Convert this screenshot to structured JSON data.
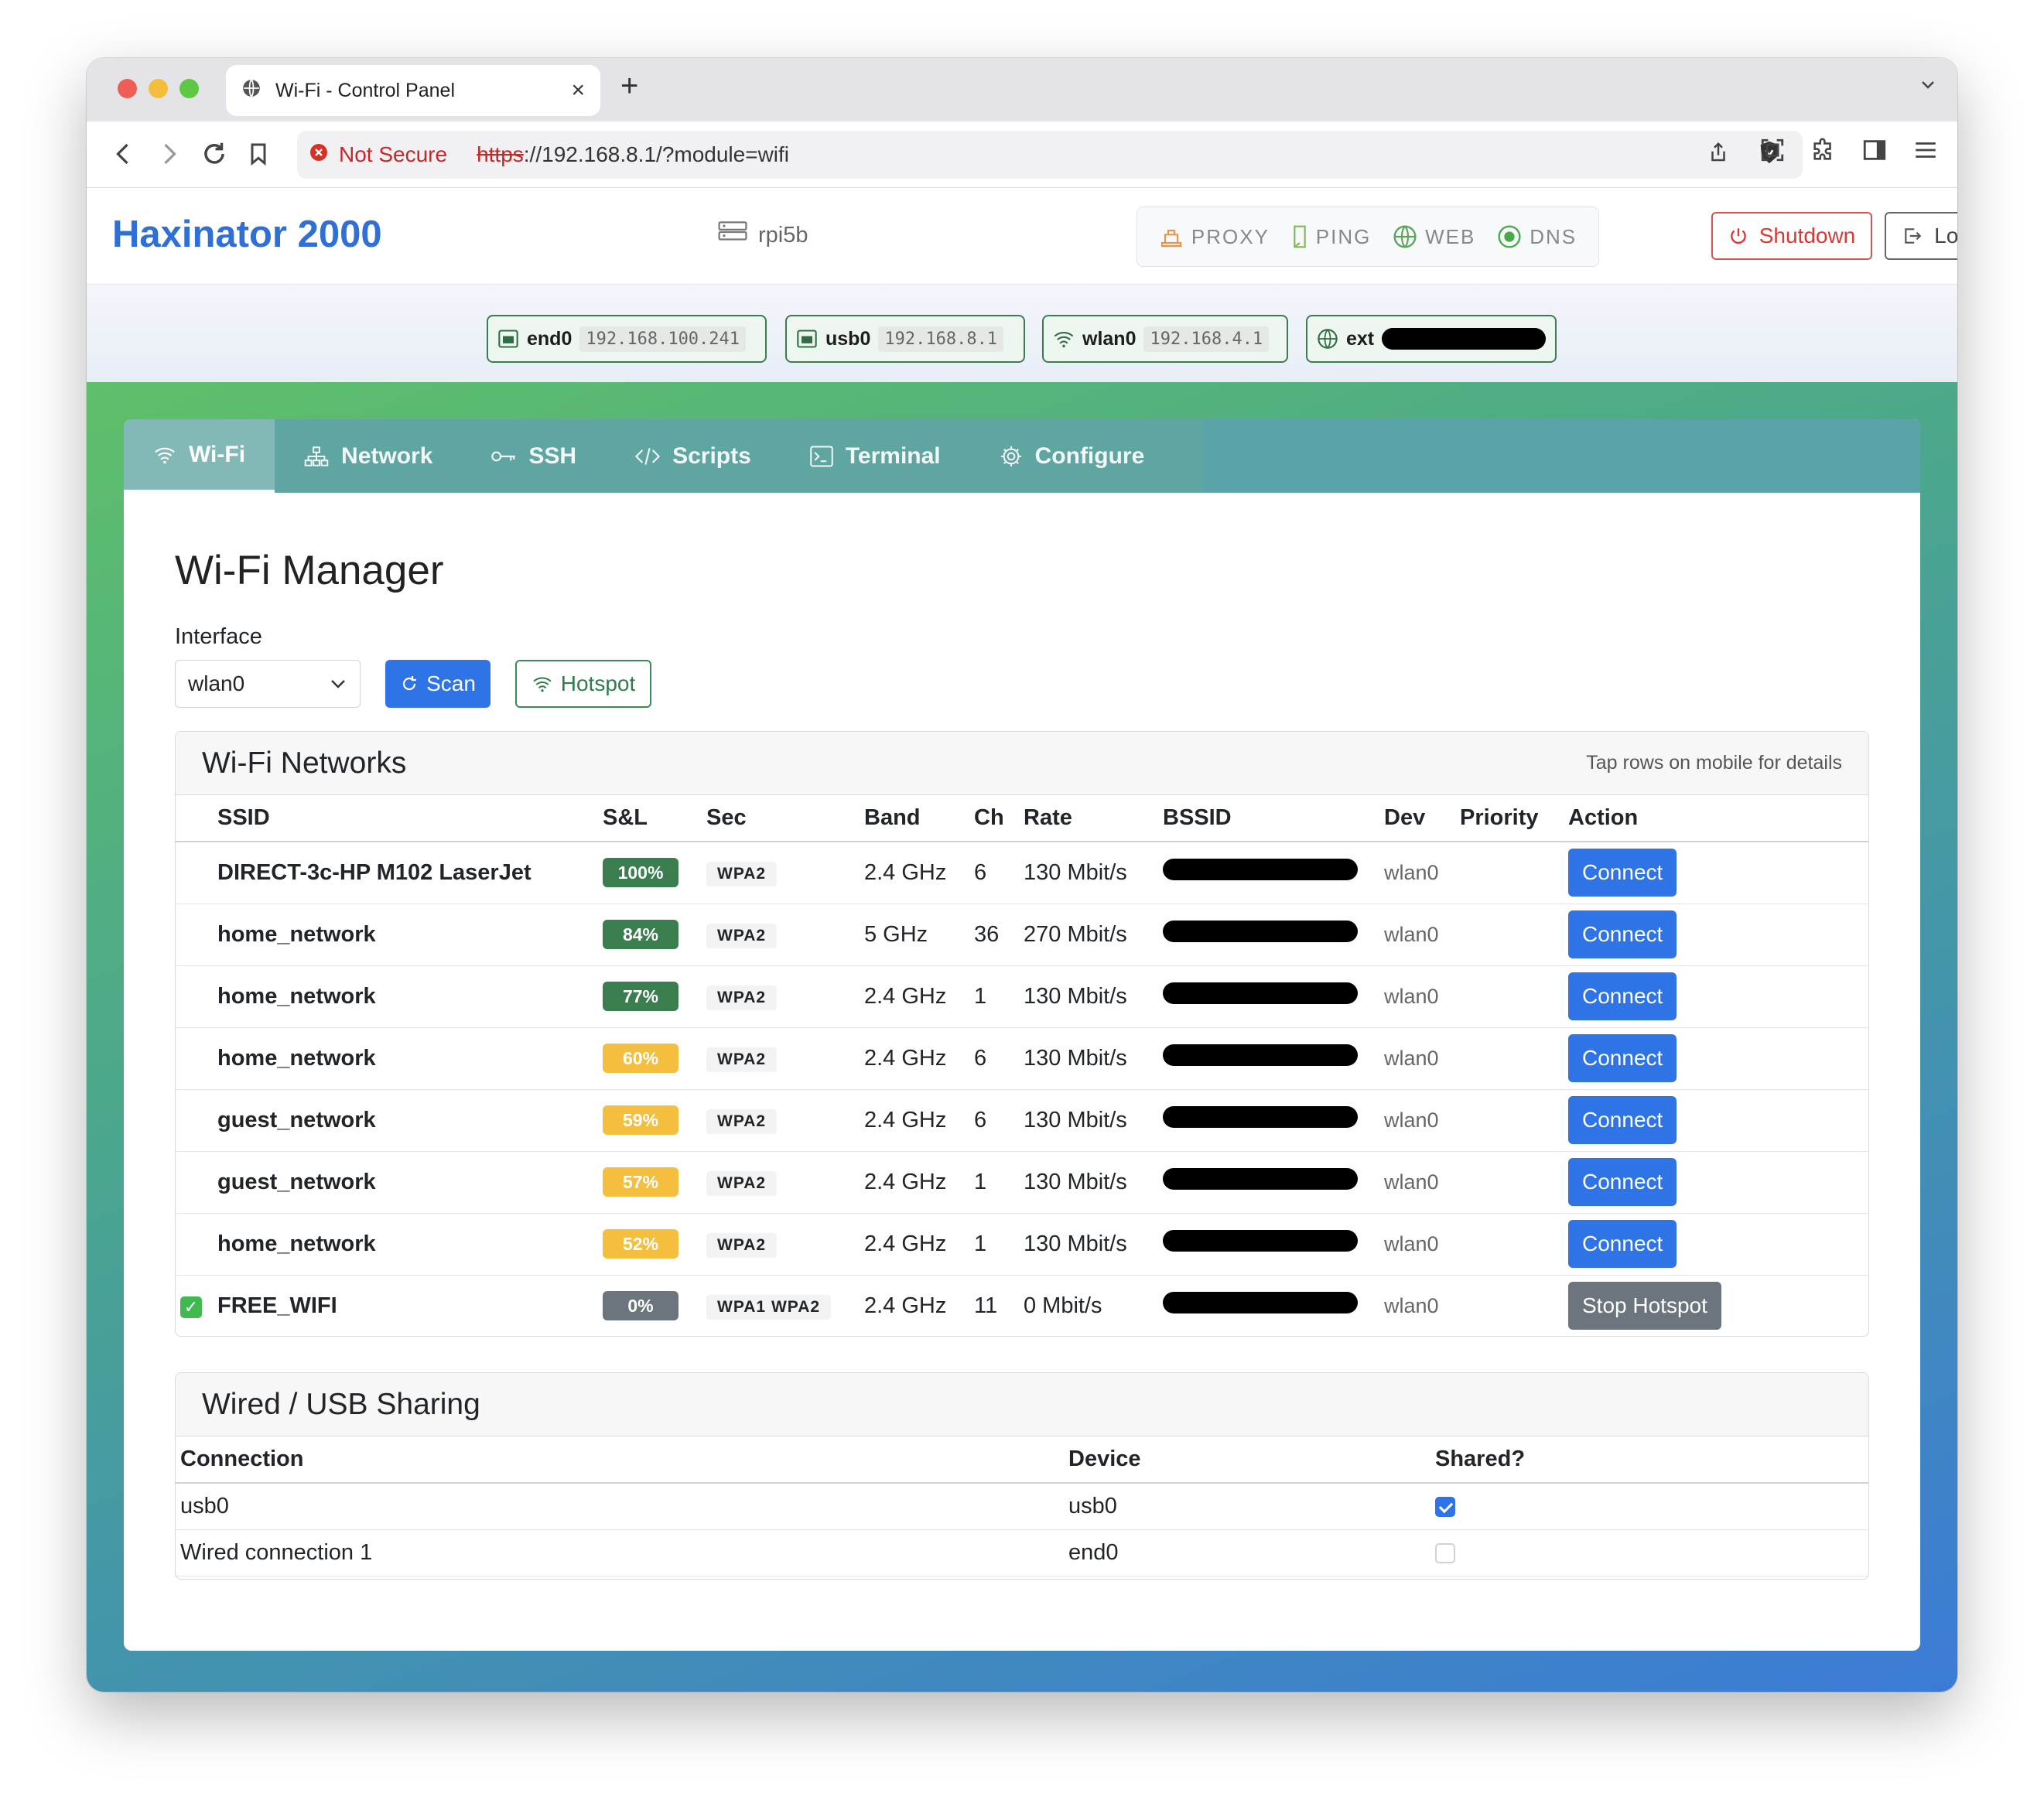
{
  "browser": {
    "tab_title": "Wi-Fi - Control Panel",
    "security_label": "Not Secure",
    "url_scheme": "https",
    "url_rest": "://192.168.8.1/?module=wifi"
  },
  "header": {
    "brand": "Haxinator 2000",
    "hostname": "rpi5b",
    "services": [
      "PROXY",
      "PING",
      "WEB",
      "DNS"
    ],
    "shutdown_label": "Shutdown",
    "logout_label": "Logout"
  },
  "interfaces": [
    {
      "name": "end0",
      "ip": "192.168.100.241",
      "icon": "ethernet-icon"
    },
    {
      "name": "usb0",
      "ip": "192.168.8.1",
      "icon": "ethernet-icon"
    },
    {
      "name": "wlan0",
      "ip": "192.168.4.1",
      "icon": "wifi-icon"
    },
    {
      "name": "ext",
      "ip": "",
      "icon": "globe-icon",
      "redacted": true
    }
  ],
  "nav_tabs": [
    {
      "label": "Wi-Fi",
      "icon": "wifi-icon",
      "active": true
    },
    {
      "label": "Network",
      "icon": "network-icon",
      "active": false
    },
    {
      "label": "SSH",
      "icon": "key-icon",
      "active": false
    },
    {
      "label": "Scripts",
      "icon": "code-icon",
      "active": false
    },
    {
      "label": "Terminal",
      "icon": "terminal-icon",
      "active": false
    },
    {
      "label": "Configure",
      "icon": "gear-icon",
      "active": false
    }
  ],
  "page": {
    "title": "Wi-Fi Manager",
    "interface_label": "Interface",
    "interface_value": "wlan0",
    "scan_label": "Scan",
    "hotspot_label": "Hotspot"
  },
  "wifi_panel": {
    "title": "Wi-Fi Networks",
    "hint": "Tap rows on mobile for details",
    "columns": [
      "SSID",
      "S&L",
      "Sec",
      "Band",
      "Ch",
      "Rate",
      "BSSID",
      "Dev",
      "Priority",
      "Action"
    ],
    "rows": [
      {
        "ssid": "DIRECT-3c-HP M102 LaserJet",
        "signal": "100%",
        "signal_color": "#3a7d4f",
        "sec": "WPA2",
        "band": "2.4 GHz",
        "ch": "6",
        "rate": "130 Mbit/s",
        "dev": "wlan0",
        "priority": "",
        "action": "Connect",
        "active": false
      },
      {
        "ssid": "home_network",
        "signal": "84%",
        "signal_color": "#3a7d4f",
        "sec": "WPA2",
        "band": "5 GHz",
        "ch": "36",
        "rate": "270 Mbit/s",
        "dev": "wlan0",
        "priority": "",
        "action": "Connect",
        "active": false
      },
      {
        "ssid": "home_network",
        "signal": "77%",
        "signal_color": "#3a7d4f",
        "sec": "WPA2",
        "band": "2.4 GHz",
        "ch": "1",
        "rate": "130 Mbit/s",
        "dev": "wlan0",
        "priority": "",
        "action": "Connect",
        "active": false
      },
      {
        "ssid": "home_network",
        "signal": "60%",
        "signal_color": "#f4bf3e",
        "sec": "WPA2",
        "band": "2.4 GHz",
        "ch": "6",
        "rate": "130 Mbit/s",
        "dev": "wlan0",
        "priority": "",
        "action": "Connect",
        "active": false
      },
      {
        "ssid": "guest_network",
        "signal": "59%",
        "signal_color": "#f4bf3e",
        "sec": "WPA2",
        "band": "2.4 GHz",
        "ch": "6",
        "rate": "130 Mbit/s",
        "dev": "wlan0",
        "priority": "",
        "action": "Connect",
        "active": false
      },
      {
        "ssid": "guest_network",
        "signal": "57%",
        "signal_color": "#f4bf3e",
        "sec": "WPA2",
        "band": "2.4 GHz",
        "ch": "1",
        "rate": "130 Mbit/s",
        "dev": "wlan0",
        "priority": "",
        "action": "Connect",
        "active": false
      },
      {
        "ssid": "home_network",
        "signal": "52%",
        "signal_color": "#f4bf3e",
        "sec": "WPA2",
        "band": "2.4 GHz",
        "ch": "1",
        "rate": "130 Mbit/s",
        "dev": "wlan0",
        "priority": "",
        "action": "Connect",
        "active": false
      },
      {
        "ssid": "FREE_WIFI",
        "signal": "0%",
        "signal_color": "#6c757d",
        "sec": "WPA1 WPA2",
        "band": "2.4 GHz",
        "ch": "11",
        "rate": "0 Mbit/s",
        "dev": "wlan0",
        "priority": "",
        "action": "Stop Hotspot",
        "active": true
      }
    ]
  },
  "wired_panel": {
    "title": "Wired / USB Sharing",
    "columns": [
      "Connection",
      "Device",
      "Shared?"
    ],
    "rows": [
      {
        "connection": "usb0",
        "device": "usb0",
        "shared": true
      },
      {
        "connection": "Wired connection 1",
        "device": "end0",
        "shared": false
      }
    ]
  },
  "colors": {
    "brand": "#2f6fd6",
    "primary": "#2e74e6",
    "danger": "#d9534f",
    "success": "#3a7d4f",
    "warning": "#f4bf3e"
  }
}
